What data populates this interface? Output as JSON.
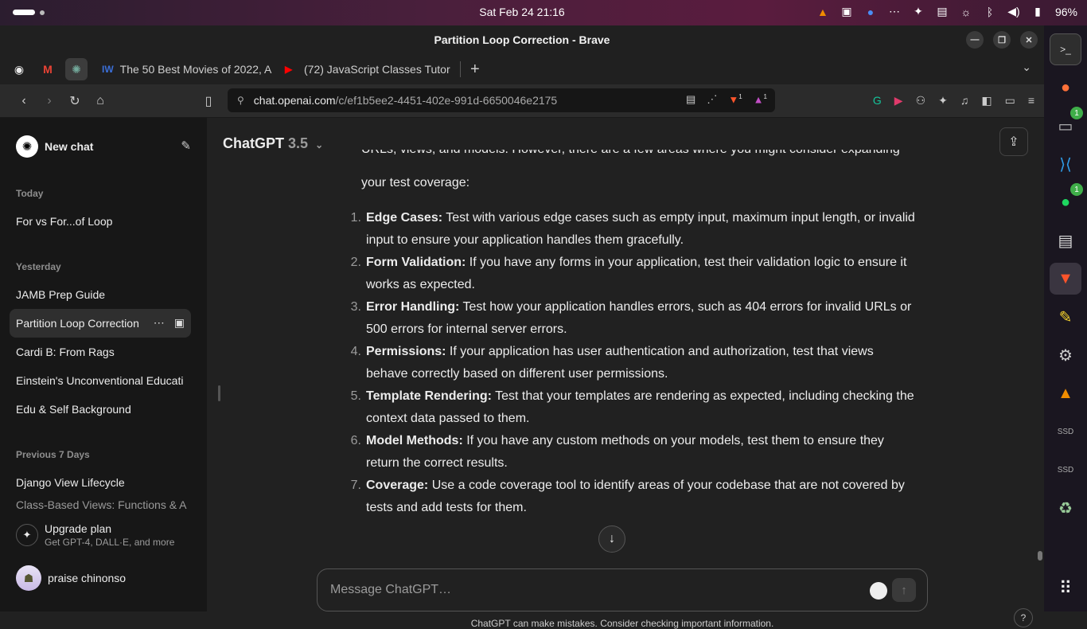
{
  "system": {
    "datetime": "Sat Feb 24  21:16",
    "battery": "96%"
  },
  "window": {
    "title": "Partition Loop Correction - Brave"
  },
  "tabs": [
    {
      "title": "The 50 Best Movies of 2022, A",
      "favicon": "IW"
    },
    {
      "title": "(72) JavaScript Classes Tutor",
      "favicon": "▶"
    }
  ],
  "address": {
    "host": "chat.openai.com",
    "path": "/c/ef1b5ee2-4451-402e-991d-6650046e2175",
    "brave_badge": "1",
    "alert_badge": "1"
  },
  "dock_badges": {
    "files": "1",
    "spotify": "1"
  },
  "sidebar": {
    "new_chat": "New chat",
    "sections": [
      {
        "title": "Today",
        "items": [
          "For vs For...of Loop"
        ]
      },
      {
        "title": "Yesterday",
        "items": [
          "JAMB Prep Guide",
          "Partition Loop Correction",
          "Cardi B: From Rags",
          "Einstein's Unconventional Educati",
          "Edu & Self Background"
        ]
      },
      {
        "title": "Previous 7 Days",
        "items": [
          "Django View Lifecycle",
          "Class-Based Views: Functions & A"
        ]
      }
    ],
    "upgrade": {
      "title": "Upgrade plan",
      "subtitle": "Get GPT-4, DALL·E, and more"
    },
    "user": "praise chinonso"
  },
  "main": {
    "model": "ChatGPT",
    "version": "3.5",
    "intro_line1": "URLs, views, and models. However, there are a few areas where you might consider expanding",
    "intro_line2": "your test coverage:",
    "items": [
      {
        "num": "1.",
        "title": "Edge Cases:",
        "text": " Test with various edge cases such as empty input, maximum input length, or invalid input to ensure your application handles them gracefully."
      },
      {
        "num": "2.",
        "title": "Form Validation:",
        "text": " If you have any forms in your application, test their validation logic to ensure it works as expected."
      },
      {
        "num": "3.",
        "title": "Error Handling:",
        "text": " Test how your application handles errors, such as 404 errors for invalid URLs or 500 errors for internal server errors."
      },
      {
        "num": "4.",
        "title": "Permissions:",
        "text": " If your application has user authentication and authorization, test that views behave correctly based on different user permissions."
      },
      {
        "num": "5.",
        "title": "Template Rendering:",
        "text": " Test that your templates are rendering as expected, including checking the context data passed to them."
      },
      {
        "num": "6.",
        "title": "Model Methods:",
        "text": " If you have any custom methods on your models, test them to ensure they return the correct results."
      },
      {
        "num": "7.",
        "title": "Coverage:",
        "text": " Use a code coverage tool to identify areas of your codebase that are not covered by tests and add tests for them."
      }
    ],
    "composer_placeholder": "Message ChatGPT…",
    "disclaimer": "ChatGPT can make mistakes. Consider checking important information.",
    "help": "?"
  }
}
